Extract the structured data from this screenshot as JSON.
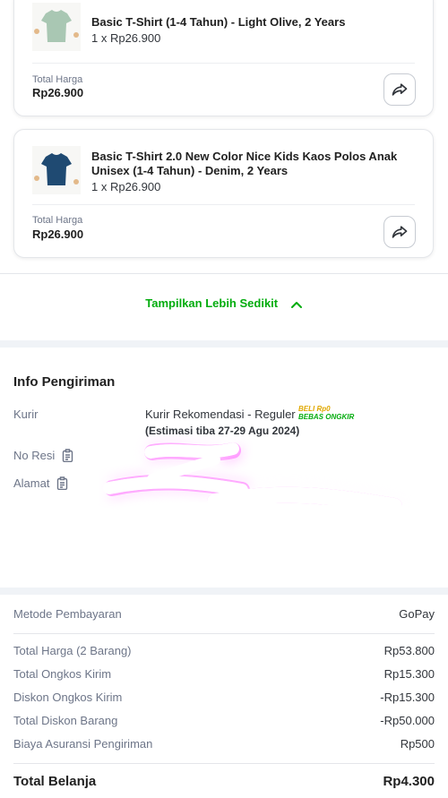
{
  "products": [
    {
      "name": "Basic T-Shirt (1-4 Tahun) - Light Olive, 2 Years",
      "qty": "1 x Rp26.900",
      "total_label": "Total Harga",
      "total_value": "Rp26.900",
      "shirt_color": "#a9c7b3"
    },
    {
      "name": "Basic T-Shirt 2.0 New Color Nice Kids Kaos Polos Anak Unisex (1-4 Tahun) - Denim, 2 Years",
      "qty": "1 x Rp26.900",
      "total_label": "Total Harga",
      "total_value": "Rp26.900",
      "shirt_color": "#1f4a72"
    }
  ],
  "show_less_label": "Tampilkan Lebih Sedikit",
  "shipping": {
    "title": "Info Pengiriman",
    "courier_label": "Kurir",
    "courier_value": "Kurir Rekomendasi - Reguler",
    "courier_estimate": "(Estimasi tiba 27-29 Agu 2024)",
    "promo_line1": "BELI Rp0",
    "promo_line2": "BEBAS ONGKIR",
    "resi_label": "No Resi",
    "address_label": "Alamat"
  },
  "payment": {
    "method_label": "Metode Pembayaran",
    "method_value": "GoPay",
    "rows": [
      {
        "label": "Total Harga (2 Barang)",
        "value": "Rp53.800"
      },
      {
        "label": "Total Ongkos Kirim",
        "value": "Rp15.300"
      },
      {
        "label": "Diskon Ongkos Kirim",
        "value": "-Rp15.300"
      },
      {
        "label": "Total Diskon Barang",
        "value": "-Rp50.000"
      },
      {
        "label": "Biaya Asuransi Pengiriman",
        "value": "Rp500"
      }
    ],
    "grand_label": "Total Belanja",
    "grand_value": "Rp4.300"
  },
  "colors": {
    "accent_green": "#03ac0e",
    "redaction_glow": "#ff3cff"
  }
}
